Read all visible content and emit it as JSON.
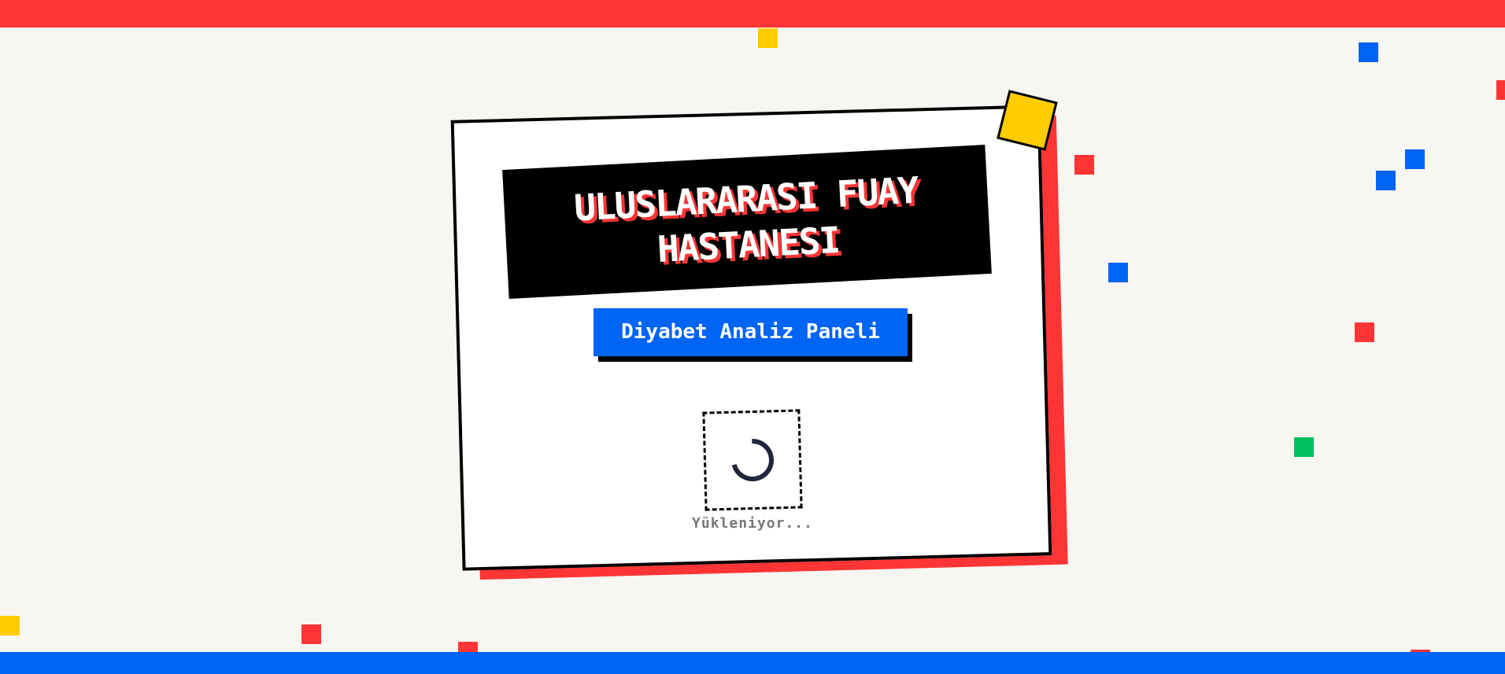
{
  "header": {
    "title": "ULUSLARARASI FUAY HASTANESI",
    "subtitle": "Diyabet Analiz Paneli"
  },
  "loading": {
    "text": "Yükleniyor..."
  },
  "colors": {
    "red": "#ff3535",
    "blue": "#0064f5",
    "yellow": "#ffcc00",
    "green": "#00c060",
    "background": "#f8f6f1"
  },
  "icons": {
    "spinner": "loading-spinner-icon"
  }
}
